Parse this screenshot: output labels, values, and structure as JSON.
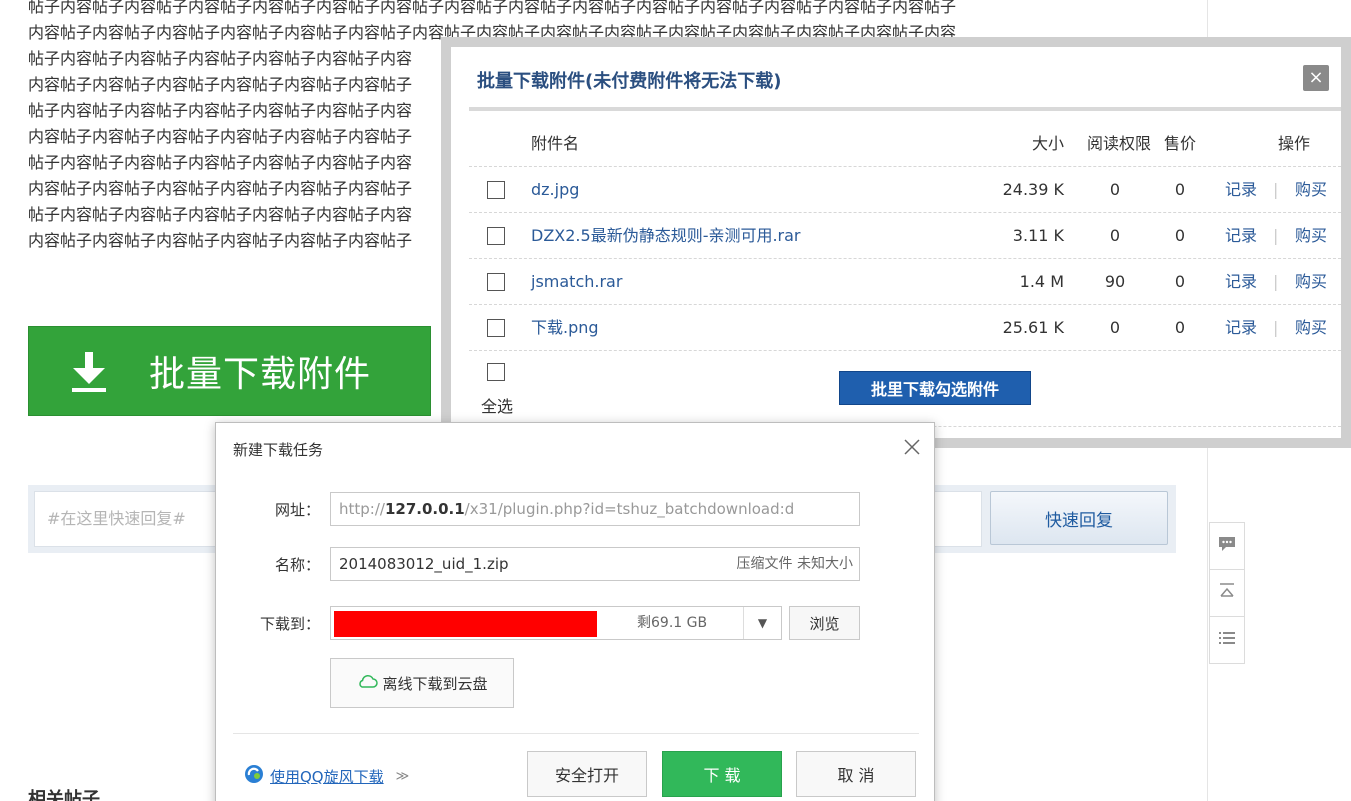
{
  "post": {
    "lines": [
      "帖子内容帖子内容帖子内容帖子内容帖子内容帖子内容帖子内容帖子内容帖子内容帖子内容帖子内容帖子内容帖子内容帖子内容帖子",
      "内容帖子内容帖子内容帖子内容帖子内容帖子内容帖子内容帖子内容帖子内容帖子内容帖子内容帖子内容帖子内容帖子内容帖子内容",
      "帖子内容帖子内容帖子内容帖子内容帖子内容帖子内容",
      "内容帖子内容帖子内容帖子内容帖子内容帖子内容帖子",
      "帖子内容帖子内容帖子内容帖子内容帖子内容帖子内容",
      "内容帖子内容帖子内容帖子内容帖子内容帖子内容帖子",
      "帖子内容帖子内容帖子内容帖子内容帖子内容帖子内容",
      "内容帖子内容帖子内容帖子内容帖子内容帖子内容帖子",
      "帖子内容帖子内容帖子内容帖子内容帖子内容帖子内容",
      "内容帖子内容帖子内容帖子内容帖子内容帖子内容帖子"
    ],
    "batch_button_label": "批量下载附件",
    "reply_placeholder": "#在这里快速回复#",
    "reply_button_label": "快速回复",
    "related_title": "相关帖子"
  },
  "batch_dialog": {
    "title": "批量下载附件(未付费附件将无法下载)",
    "close_glyph": "×",
    "headers": {
      "name": "附件名",
      "size": "大小",
      "permission": "阅读权限",
      "price": "售价",
      "action": "操作"
    },
    "rows": [
      {
        "name": "dz.jpg",
        "size": "24.39 K",
        "permission": "0",
        "price": "0"
      },
      {
        "name": "DZX2.5最新伪静态规则-亲测可用.rar",
        "size": "3.11 K",
        "permission": "0",
        "price": "0"
      },
      {
        "name": "jsmatch.rar",
        "size": "1.4 M",
        "permission": "90",
        "price": "0"
      },
      {
        "name": "下载.png",
        "size": "25.61 K",
        "permission": "0",
        "price": "0"
      }
    ],
    "log_label": "记录",
    "separator": "|",
    "buy_label": "购买",
    "select_all_label": "全选",
    "download_selected_label": "批里下载勾选附件"
  },
  "task_dialog": {
    "title": "新建下载任务",
    "url_label": "网址：",
    "url_prefix": "http://",
    "url_host": "127.0.0.1",
    "url_rest": "/x31/plugin.php?id=tshuz_batchdownload:d",
    "name_label": "名称：",
    "name_value": "2014083012_uid_1.zip",
    "name_meta": "压缩文件 未知大小",
    "path_label": "下载到：",
    "path_free": "剩69.1 GB",
    "dropdown_glyph": "▼",
    "browse_label": "浏览",
    "cloud_label": "离线下载到云盘",
    "qq_label": "使用QQ旋风下载",
    "qq_chevron": "≫",
    "safe_open_label": "安全打开",
    "download_label": "下 载",
    "cancel_label": "取 消"
  },
  "colors": {
    "batch_button": "#33a33a",
    "link": "#2b5a98",
    "primary_button": "#1f5fae",
    "download_green": "#31b85a",
    "path_redaction": "#ff0000"
  },
  "icons": [
    "download-arrow-icon",
    "close-icon",
    "comment-icon",
    "back-to-top-icon",
    "list-icon",
    "cloud-icon",
    "qq-xuanfeng-icon",
    "chevron-down-icon"
  ]
}
